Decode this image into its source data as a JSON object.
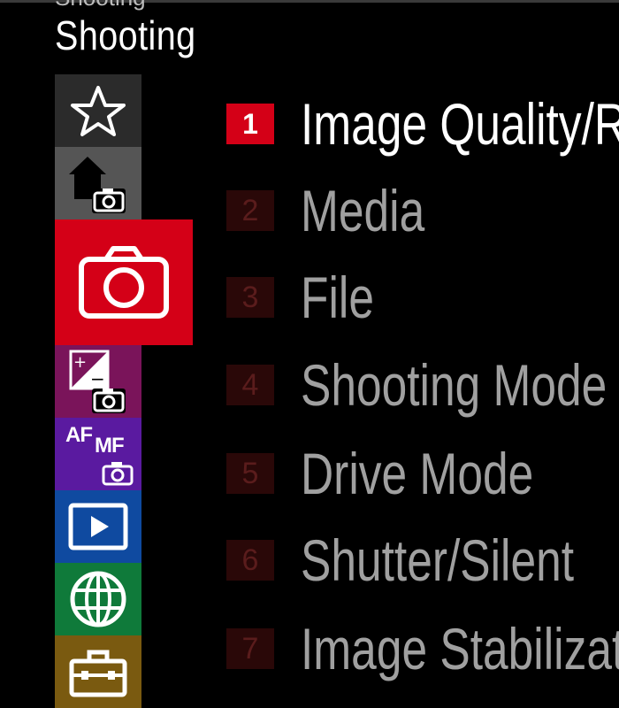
{
  "header": {
    "cut_text": "Shooting",
    "title": "Shooting"
  },
  "tabs": [
    {
      "name": "my-menu",
      "icon": "star-icon",
      "color": "#2b2b2b"
    },
    {
      "name": "main",
      "icon": "home-camera-icon",
      "color": "#555555"
    },
    {
      "name": "shooting",
      "icon": "camera-icon",
      "color": "#d40017",
      "selected": true
    },
    {
      "name": "exposure-color",
      "icon": "exposure-comp-icon",
      "color": "#7a145a"
    },
    {
      "name": "focus",
      "icon": "af-mf-icon",
      "af_label": "AF",
      "mf_label": "MF",
      "color": "#5a1aa0"
    },
    {
      "name": "playback",
      "icon": "playback-icon",
      "color": "#0f4aa0"
    },
    {
      "name": "network",
      "icon": "globe-icon",
      "color": "#0f7a3a"
    },
    {
      "name": "setup",
      "icon": "toolbox-icon",
      "color": "#7a5a10"
    }
  ],
  "menu_items": [
    {
      "num": "1",
      "label": "Image Quality/R",
      "active": true
    },
    {
      "num": "2",
      "label": "Media",
      "active": false
    },
    {
      "num": "3",
      "label": "File",
      "active": false
    },
    {
      "num": "4",
      "label": "Shooting Mode",
      "active": false
    },
    {
      "num": "5",
      "label": "Drive Mode",
      "active": false
    },
    {
      "num": "6",
      "label": "Shutter/Silent",
      "active": false
    },
    {
      "num": "7",
      "label": "Image Stabilizat",
      "active": false
    }
  ],
  "colors": {
    "accent": "#d40017",
    "active_text": "#ffffff",
    "inactive_text": "#a0a0a0",
    "inactive_num_bg": "#2a0808"
  }
}
